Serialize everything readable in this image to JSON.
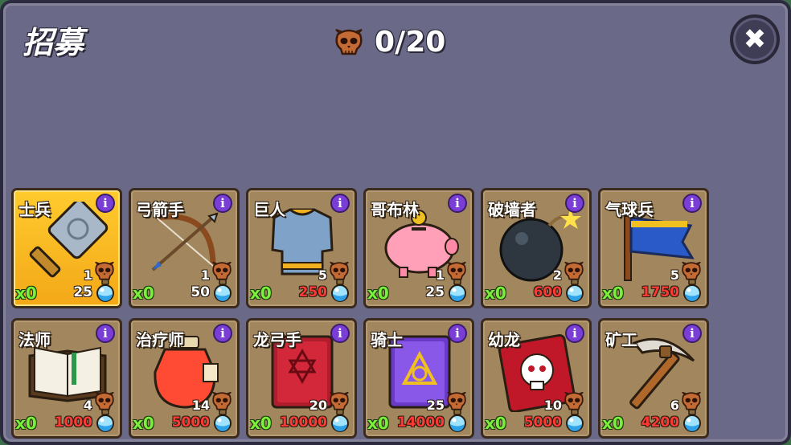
{
  "header": {
    "title": "招募",
    "counter": "0/20",
    "close_label": "✖"
  },
  "colors": {
    "panel": "#6b6988",
    "card": "#a2865e",
    "selected_card": "#f3a818",
    "count_green": "#7af03a",
    "cost_red": "#ff3a34",
    "info_purple": "#7a3dd6"
  },
  "units": [
    {
      "name": "士兵",
      "art": "hammer",
      "slots": "1",
      "count": "x0",
      "cost": "25",
      "affordable": true,
      "selected": true
    },
    {
      "name": "弓箭手",
      "art": "bow",
      "slots": "1",
      "count": "x0",
      "cost": "50",
      "affordable": true,
      "selected": false
    },
    {
      "name": "巨人",
      "art": "armor",
      "slots": "5",
      "count": "x0",
      "cost": "250",
      "affordable": false,
      "selected": false
    },
    {
      "name": "哥布林",
      "art": "piggy-bank",
      "slots": "1",
      "count": "x0",
      "cost": "25",
      "affordable": true,
      "selected": false
    },
    {
      "name": "破墙者",
      "art": "bomb",
      "slots": "2",
      "count": "x0",
      "cost": "600",
      "affordable": false,
      "selected": false
    },
    {
      "name": "气球兵",
      "art": "flag",
      "slots": "5",
      "count": "x0",
      "cost": "1750",
      "affordable": false,
      "selected": false
    },
    {
      "name": "法师",
      "art": "open-book",
      "slots": "4",
      "count": "x0",
      "cost": "1000",
      "affordable": false,
      "selected": false
    },
    {
      "name": "治疗师",
      "art": "potion-jar",
      "slots": "14",
      "count": "x0",
      "cost": "5000",
      "affordable": false,
      "selected": false
    },
    {
      "name": "龙弓手",
      "art": "red-tome",
      "slots": "20",
      "count": "x0",
      "cost": "10000",
      "affordable": false,
      "selected": false
    },
    {
      "name": "骑士",
      "art": "purple-tome",
      "slots": "25",
      "count": "x0",
      "cost": "14000",
      "affordable": false,
      "selected": false
    },
    {
      "name": "幼龙",
      "art": "skull-ticket",
      "slots": "10",
      "count": "x0",
      "cost": "5000",
      "affordable": false,
      "selected": false
    },
    {
      "name": "矿工",
      "art": "pickaxe",
      "slots": "6",
      "count": "x0",
      "cost": "4200",
      "affordable": false,
      "selected": false
    }
  ],
  "info_label": "i"
}
